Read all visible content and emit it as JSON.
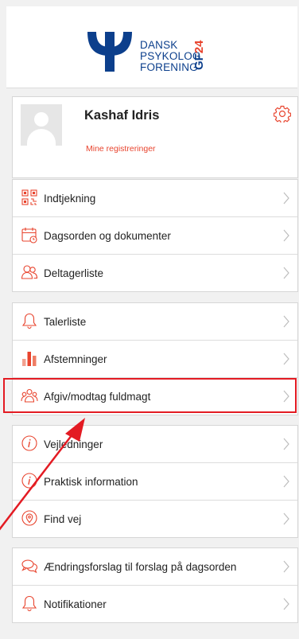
{
  "brand": {
    "org_lines": [
      "DANSK",
      "PSYKOLOG",
      "FORENING"
    ],
    "event_gf": "GF",
    "event_year": "24",
    "colors": {
      "blue": "#0c3f8c",
      "accent": "#e8442e"
    }
  },
  "profile": {
    "name": "Kashaf Idris",
    "registrations_link": "Mine registreringer",
    "settings_icon": "gear-icon",
    "avatar_icon": "user-placeholder-icon"
  },
  "menu_groups": [
    [
      {
        "label": "Indtjekning",
        "icon": "qr-code-icon"
      },
      {
        "label": "Dagsorden og dokumenter",
        "icon": "calendar-icon"
      },
      {
        "label": "Deltagerliste",
        "icon": "people-icon"
      }
    ],
    [
      {
        "label": "Talerliste",
        "icon": "bell-icon"
      },
      {
        "label": "Afstemninger",
        "icon": "bar-chart-icon"
      },
      {
        "label": "Afgiv/modtag fuldmagt",
        "icon": "group-icon"
      }
    ],
    [
      {
        "label": "Vejledninger",
        "icon": "info-icon"
      },
      {
        "label": "Praktisk information",
        "icon": "info-icon"
      },
      {
        "label": "Find vej",
        "icon": "location-pin-icon"
      }
    ],
    [
      {
        "label": "Ændringsforslag til forslag på dagsorden",
        "icon": "chat-bubbles-icon"
      },
      {
        "label": "Notifikationer",
        "icon": "bell-icon"
      }
    ]
  ],
  "annotation": {
    "highlight_color": "#e31b23",
    "target": "Afgiv/modtag fuldmagt"
  }
}
